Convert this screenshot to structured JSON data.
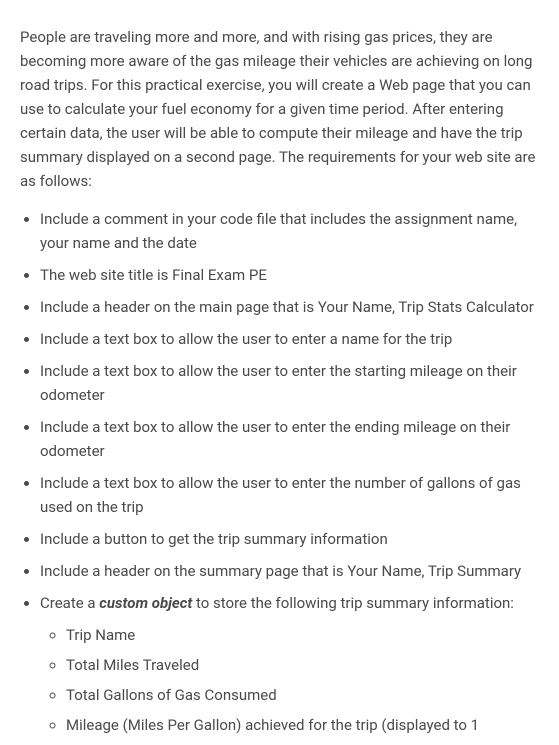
{
  "intro": "People are traveling more and more, and with rising gas prices, they are becoming more aware of the gas mileage their vehicles are achieving on long road trips. For this practical exercise, you will create a Web page that you can use to calculate your fuel economy for a given time period. After entering certain data, the user will be able to compute their mileage and have the trip summary displayed on a second page. The requirements for your web site are as follows:",
  "items": [
    "Include a comment in your code file that includes the assignment name, your name and the date",
    "The web site title is Final Exam PE",
    "Include a header on the main page that is Your Name, Trip Stats Calculator",
    "Include a text box to allow the user to enter a name for the trip",
    "Include a text box to allow the user to enter the starting mileage on their odometer",
    "Include a text box to allow the user to enter the ending mileage on their odometer",
    "Include a text box to allow the user to enter the number of gallons of gas used on the trip",
    "Include a button to get the trip summary information",
    "Include a header on the summary page that is Your Name, Trip Summary"
  ],
  "customObj": {
    "pre": "Create a ",
    "em": "custom object",
    "post": " to store the following trip summary information:",
    "sub": [
      "Trip Name",
      "Total Miles Traveled",
      "Total Gallons of Gas Consumed",
      "Mileage (Miles Per Gallon) achieved for the trip (displayed to 1"
    ]
  }
}
